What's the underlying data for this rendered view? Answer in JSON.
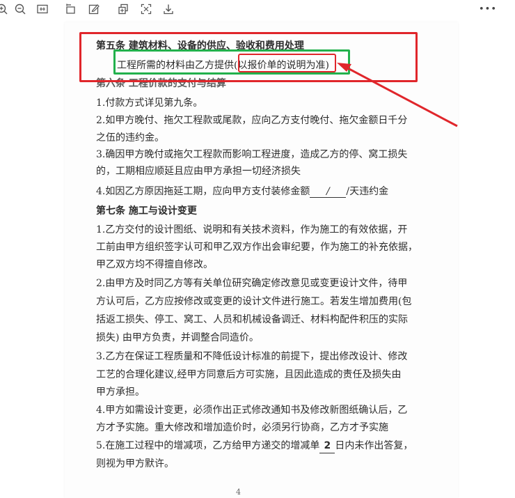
{
  "toolbar": {
    "buttons": [
      {
        "name": "zoom-in-button",
        "icon": "zoom-in-icon"
      },
      {
        "name": "zoom-out-button",
        "icon": "zoom-out-icon"
      },
      {
        "name": "fit-width-button",
        "icon": "fit-width-icon"
      },
      {
        "name": "rotate-button",
        "icon": "rotate-icon"
      },
      {
        "name": "edit-button",
        "icon": "edit-icon"
      },
      {
        "name": "copy-button",
        "icon": "copy-icon"
      },
      {
        "name": "fullscreen-button",
        "icon": "fullscreen-icon"
      },
      {
        "name": "download-button",
        "icon": "download-icon"
      }
    ],
    "more_label": "•••"
  },
  "document": {
    "article5_title": "第五条  建筑材料、设备的供应、验收和费用处理",
    "article5_body": "工程所需的材料由乙方提供(以报价单的说明为准)",
    "article6_title": "第六条  工程价款的支付与结算",
    "a6_1": "1.付款方式详见第九条。",
    "a6_2a": "2.如甲方晚付、拖欠工程款或尾款，应向乙方支付晚付、拖欠金额日千分",
    "a6_2b": "之伍的违约金。",
    "a6_3a": "3.确因甲方晚付或拖欠工程款而影响工程进度，造成乙方的停、窝工损失",
    "a6_3b": "的，工期相应顺延且应由甲方承担一切经济损失",
    "a6_4_pre": "4.如因乙方原因拖延工期，应向甲方支付装修金额",
    "a6_4_blank": "/",
    "a6_4_post": "/天违约金",
    "article7_title": "第七条  施工与设计变更",
    "a7_1a": "1.乙方交付的设计图纸、说明和有关技术资料，作为施工的有效依据，开",
    "a7_1b": "工前由甲方组织签字认可和甲乙双方作出会审纪要，作为施工的补充依据，",
    "a7_1c": "甲乙双方均不得擅自修改。",
    "a7_2a": "2.由甲方及时同乙方等有关单位研究确定修改意见或变更设计文件，待甲",
    "a7_2b": "方认可后，乙方应按修改或变更的设计文件进行施工。若发生增加费用(包",
    "a7_2c": "括返工损失、停工、窝工、人员和机械设备调迁、材料构配件积压的实际",
    "a7_2d": "损失) 由甲方负责，并调整合同造价。",
    "a7_3a": "3.乙方在保证工程质量和不降低设计标准的前提下，提出修改设计、修改",
    "a7_3b": "工艺的合理化建议,经甲方同意后方可实施，且因此造成的责任及损失由",
    "a7_3c": "甲方承担。",
    "a7_4a": "4.甲方如需设计变更，必须作出正式修改通知书及修改新图纸确认后，乙",
    "a7_4b": "方才予实施。重大修改和增加造价时，必须另行协商，乙方才予实施",
    "a7_5a_pre": "5.在施工过程中的增减项，乙方给甲方递交的增减单",
    "a7_5a_num": "2",
    "a7_5a_post": "日内未作出答复，",
    "a7_5b": "则视为甲方默许。",
    "page_number": "4"
  },
  "annotations": {
    "red_color": "#e0262b",
    "green_color": "#22b14c"
  }
}
